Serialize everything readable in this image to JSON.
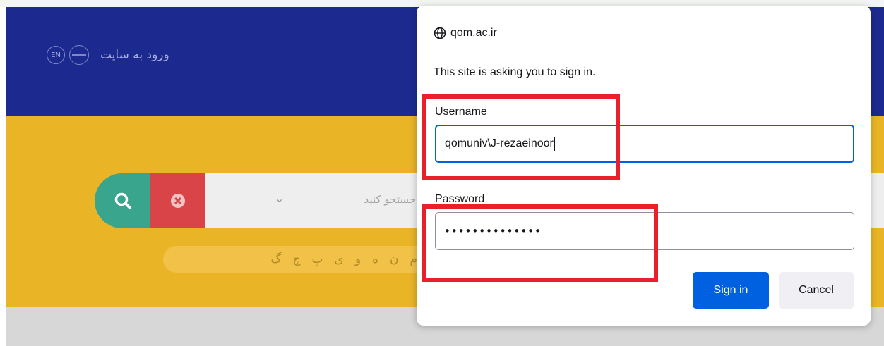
{
  "background": {
    "header": {
      "en_badge": "EN",
      "login_link": "ورود به سایت"
    },
    "search": {
      "placeholder": "جستجو کنید",
      "letters": [
        "گ",
        "چ",
        "پ",
        "ی",
        "و",
        "ه",
        "ن",
        "م"
      ]
    }
  },
  "dialog": {
    "origin": "qom.ac.ir",
    "message": "This site is asking you to sign in.",
    "username_label": "Username",
    "username_value": "qomuniv\\J-rezaeinoor",
    "password_label": "Password",
    "password_mask": "••••••••••••••",
    "signin_label": "Sign in",
    "cancel_label": "Cancel"
  },
  "colors": {
    "header_blue": "#1c2a8f",
    "banner_yellow": "#e9b526",
    "accent_blue": "#0061e0",
    "annotation_red": "#e8202a"
  },
  "icons": {
    "origin": "globe-icon",
    "search": "search-icon",
    "clear": "close-circle-icon"
  }
}
